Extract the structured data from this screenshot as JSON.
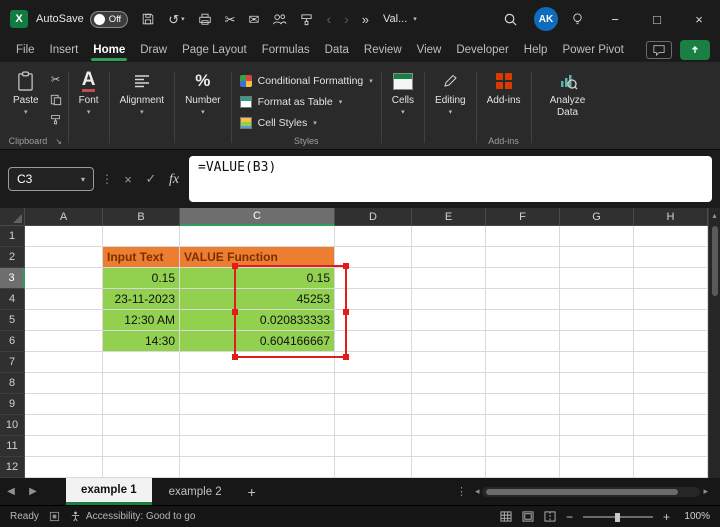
{
  "title_bar": {
    "autosave_label": "AutoSave",
    "autosave_state": "Off",
    "quick_access": "Val...",
    "avatar_initials": "AK"
  },
  "menu_bar": {
    "items": [
      "File",
      "Insert",
      "Home",
      "Draw",
      "Page Layout",
      "Formulas",
      "Data",
      "Review",
      "View",
      "Developer",
      "Help",
      "Power Pivot"
    ],
    "active": "Home"
  },
  "ribbon": {
    "paste_label": "Paste",
    "clipboard_group_label": "Clipboard",
    "font_label": "Font",
    "alignment_label": "Alignment",
    "number_label": "Number",
    "conditional_formatting_label": "Conditional Formatting",
    "format_as_table_label": "Format as Table",
    "cell_styles_label": "Cell Styles",
    "styles_group_label": "Styles",
    "cells_label": "Cells",
    "editing_label": "Editing",
    "addins_label": "Add-ins",
    "addins_group_label": "Add-ins",
    "analyze_data_label": "Analyze Data"
  },
  "formula_bar": {
    "name_box": "C3",
    "fx_label": "fx",
    "formula": "=VALUE(B3)"
  },
  "grid": {
    "column_headers": [
      "A",
      "B",
      "C",
      "D",
      "E",
      "F",
      "G",
      "H"
    ],
    "row_headers": [
      "1",
      "2",
      "3",
      "4",
      "5",
      "6",
      "7",
      "8",
      "9",
      "10",
      "11",
      "12"
    ],
    "active_cell": "C3",
    "selected_column": "C",
    "selected_row": "3"
  },
  "sheet": {
    "b2": "Input Text",
    "c2": "VALUE Function",
    "rows": [
      {
        "input": "0.15",
        "value": "0.15"
      },
      {
        "input": "23-11-2023",
        "value": "45253"
      },
      {
        "input": "12:30 AM",
        "value": "0.020833333"
      },
      {
        "input": "14:30",
        "value": "0.604166667"
      }
    ]
  },
  "sheet_tabs": {
    "tab1": "example 1",
    "tab2": "example 2"
  },
  "status_bar": {
    "mode": "Ready",
    "accessibility": "Accessibility: Good to go",
    "zoom_level": "100%"
  },
  "colors": {
    "accent_green": "#2e9e5b",
    "header_fill": "#ED7D31",
    "header_text": "#7a3000",
    "cell_fill": "#92D050",
    "annotation_red": "#e31b1b",
    "avatar_blue": "#0f6cbd"
  },
  "icons": {
    "excel_x": "X",
    "undo": "↺",
    "back": "‹",
    "forward": "›",
    "overflow": "»",
    "dropdown": "▾",
    "more_vertical": "⋮",
    "confirm": "✓",
    "close": "×",
    "minimize": "−",
    "maximize": "□",
    "cut": "✂",
    "mail": "✉",
    "nav_left": "◀",
    "nav_right": "▶",
    "scroll_left": "◂",
    "scroll_right": "▸",
    "scroll_up": "▴",
    "add": "+",
    "launcher": "↘",
    "font": "A",
    "percent": "%"
  }
}
